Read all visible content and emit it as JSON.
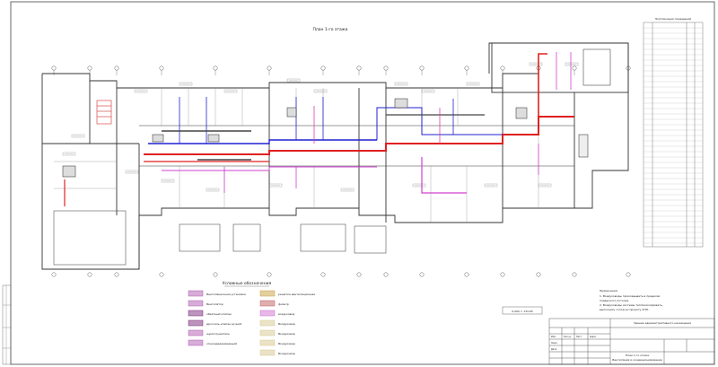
{
  "plan": {
    "title": "План 1-го этажа",
    "scale_label": "0.000 = 133.65"
  },
  "legend": {
    "title": "Условные обозначения",
    "items": [
      {
        "label": "Вентиляционная установка",
        "color": "#b05bb0"
      },
      {
        "label": "Вентилятор",
        "color": "#b05bb0"
      },
      {
        "label": "обратный клапан",
        "color": "#7a2a7a"
      },
      {
        "label": "дроссель-клапан ручной",
        "color": "#7a2a7a"
      },
      {
        "label": "шумоглушитель",
        "color": "#b05bb0"
      },
      {
        "label": "огнезадерживающий",
        "color": "#b05bb0"
      },
      {
        "label": "решетка вентиляционная",
        "color": "#c8a040"
      },
      {
        "label": "фильтр",
        "color": "#c06060"
      },
      {
        "label": "воздуховод",
        "color": "#d070d0"
      },
      {
        "label": "Воздуховод",
        "color": "#d8c890"
      },
      {
        "label": "Воздуховод",
        "color": "#d8c890"
      },
      {
        "label": "Воздуховод",
        "color": "#d8c890"
      },
      {
        "label": "Воздуховод",
        "color": "#d8c890"
      }
    ]
  },
  "notes": {
    "title": "Примечания:",
    "lines": [
      "1. Воздуховоды прокладывать в пределах",
      "подвесного потолка.",
      "2. Воздуховоды системы теплоизолировать,",
      "выполнить согласно проекту СНП."
    ]
  },
  "title_block": {
    "header": "Здание административного назначения",
    "rows": [
      "Изм.",
      "Кол.уч",
      "Лист",
      "№док",
      "Подп.",
      "Дата"
    ],
    "sheet_title": "План 1-го этажа",
    "sheet_subtitle": "Вентиляция и кондиционирование"
  },
  "spec_table": {
    "title": "Экспликация помещений"
  },
  "colors": {
    "supply": "#e02020",
    "exhaust": "#2020d0",
    "duct_violet": "#d040d0",
    "walls": "#333333"
  }
}
